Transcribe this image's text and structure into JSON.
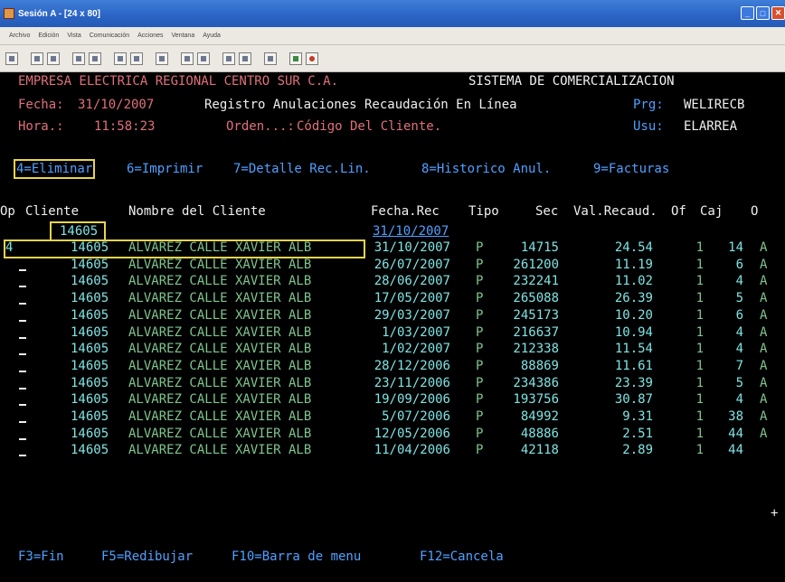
{
  "window": {
    "title": "Sesión A - [24 x 80]"
  },
  "menu": [
    "Archivo",
    "Edición",
    "Vista",
    "Comunicación",
    "Acciones",
    "Ventana",
    "Ayuda"
  ],
  "header": {
    "company": "EMPRESA ELECTRICA REGIONAL CENTRO SUR C.A.",
    "system": "SISTEMA DE COMERCIALIZACION",
    "date_label": "Fecha:",
    "date": "31/10/2007",
    "screen_title": "Registro Anulaciones Recaudación En Línea",
    "prg_label": "Prg:",
    "prg": "WELIRECB",
    "time_label": "Hora.:",
    "time": "11:58:23",
    "order_label": "Orden...:",
    "order": "Código Del Cliente.",
    "usu_label": "Usu:",
    "usu": "ELARREA"
  },
  "options": {
    "opt4": "4=Eliminar",
    "opt6": "6=Imprimir",
    "opt7": "7=Detalle Rec.Lin.",
    "opt8": "8=Historico Anul.",
    "opt9": "9=Facturas"
  },
  "columns": {
    "op": "Op",
    "cliente": "Cliente",
    "nombre": "Nombre del Cliente",
    "fecha": "Fecha.Rec",
    "tipo": "Tipo",
    "sec": "Sec",
    "valor": "Val.Recaud.",
    "of": "Of",
    "caj": "Caj",
    "o": "O"
  },
  "filter": {
    "cliente": "14605",
    "fecha": "31/10/2007"
  },
  "rows": [
    {
      "op": "4",
      "cliente": "14605",
      "nombre": "ALVAREZ CALLE XAVIER ALB",
      "fecha": "31/10/2007",
      "tipo": "P",
      "sec": "14715",
      "valor": "24.54",
      "of": "1",
      "caj": "14",
      "o": "A"
    },
    {
      "op": "",
      "cliente": "14605",
      "nombre": "ALVAREZ CALLE XAVIER ALB",
      "fecha": "26/07/2007",
      "tipo": "P",
      "sec": "261200",
      "valor": "11.19",
      "of": "1",
      "caj": "6",
      "o": "A"
    },
    {
      "op": "",
      "cliente": "14605",
      "nombre": "ALVAREZ CALLE XAVIER ALB",
      "fecha": "28/06/2007",
      "tipo": "P",
      "sec": "232241",
      "valor": "11.02",
      "of": "1",
      "caj": "4",
      "o": "A"
    },
    {
      "op": "",
      "cliente": "14605",
      "nombre": "ALVAREZ CALLE XAVIER ALB",
      "fecha": "17/05/2007",
      "tipo": "P",
      "sec": "265088",
      "valor": "26.39",
      "of": "1",
      "caj": "5",
      "o": "A"
    },
    {
      "op": "",
      "cliente": "14605",
      "nombre": "ALVAREZ CALLE XAVIER ALB",
      "fecha": "29/03/2007",
      "tipo": "P",
      "sec": "245173",
      "valor": "10.20",
      "of": "1",
      "caj": "6",
      "o": "A"
    },
    {
      "op": "",
      "cliente": "14605",
      "nombre": "ALVAREZ CALLE XAVIER ALB",
      "fecha": "1/03/2007",
      "tipo": "P",
      "sec": "216637",
      "valor": "10.94",
      "of": "1",
      "caj": "4",
      "o": "A"
    },
    {
      "op": "",
      "cliente": "14605",
      "nombre": "ALVAREZ CALLE XAVIER ALB",
      "fecha": "1/02/2007",
      "tipo": "P",
      "sec": "212338",
      "valor": "11.54",
      "of": "1",
      "caj": "4",
      "o": "A"
    },
    {
      "op": "",
      "cliente": "14605",
      "nombre": "ALVAREZ CALLE XAVIER ALB",
      "fecha": "28/12/2006",
      "tipo": "P",
      "sec": "88869",
      "valor": "11.61",
      "of": "1",
      "caj": "7",
      "o": "A"
    },
    {
      "op": "",
      "cliente": "14605",
      "nombre": "ALVAREZ CALLE XAVIER ALB",
      "fecha": "23/11/2006",
      "tipo": "P",
      "sec": "234386",
      "valor": "23.39",
      "of": "1",
      "caj": "5",
      "o": "A"
    },
    {
      "op": "",
      "cliente": "14605",
      "nombre": "ALVAREZ CALLE XAVIER ALB",
      "fecha": "19/09/2006",
      "tipo": "P",
      "sec": "193756",
      "valor": "30.87",
      "of": "1",
      "caj": "4",
      "o": "A"
    },
    {
      "op": "",
      "cliente": "14605",
      "nombre": "ALVAREZ CALLE XAVIER ALB",
      "fecha": "5/07/2006",
      "tipo": "P",
      "sec": "84992",
      "valor": "9.31",
      "of": "1",
      "caj": "38",
      "o": "A"
    },
    {
      "op": "",
      "cliente": "14605",
      "nombre": "ALVAREZ CALLE XAVIER ALB",
      "fecha": "12/05/2006",
      "tipo": "P",
      "sec": "48886",
      "valor": "2.51",
      "of": "1",
      "caj": "44",
      "o": "A"
    },
    {
      "op": "",
      "cliente": "14605",
      "nombre": "ALVAREZ CALLE XAVIER ALB",
      "fecha": "11/04/2006",
      "tipo": "P",
      "sec": "42118",
      "valor": "2.89",
      "of": "1",
      "caj": "44",
      "o": ""
    }
  ],
  "more_indicator": "+",
  "footer": {
    "f3": "F3=Fin",
    "f5": "F5=Redibujar",
    "f10": "F10=Barra de menu",
    "f12": "F12=Cancela"
  },
  "colors": {
    "background": "#000000",
    "white_text": "#f0f0f0",
    "cyan_text": "#7fe3e3",
    "blue_text": "#4fa0ff",
    "red_text": "#e0707a",
    "green_text": "#7ec58e",
    "highlight_box": "#e8d44a"
  }
}
